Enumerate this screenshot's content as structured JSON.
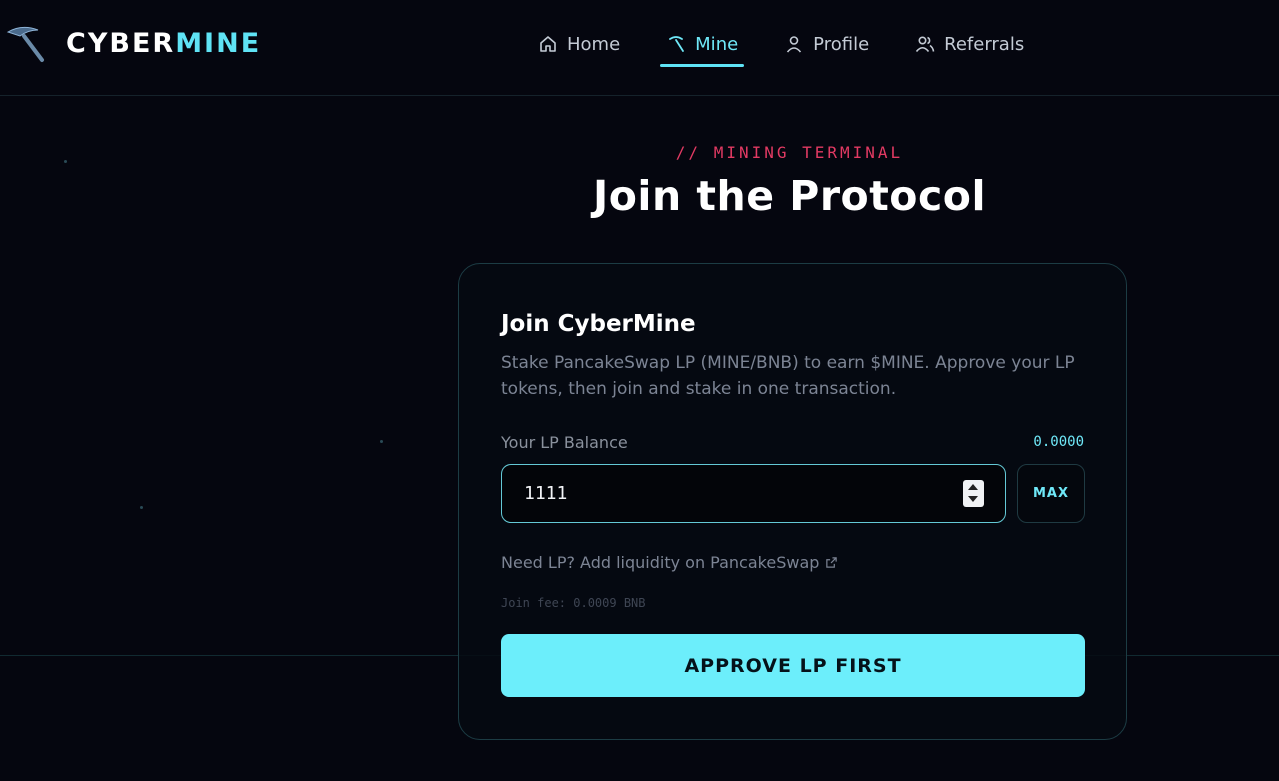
{
  "brand": {
    "part1": "CYBER",
    "part2": "MINE",
    "accent_color": "#5fe3f5"
  },
  "nav": {
    "items": [
      {
        "label": "Home",
        "icon": "home-icon"
      },
      {
        "label": "Mine",
        "icon": "pickaxe-icon",
        "active": true
      },
      {
        "label": "Profile",
        "icon": "user-icon"
      },
      {
        "label": "Referrals",
        "icon": "users-icon"
      }
    ]
  },
  "hero": {
    "kicker": "// MINING TERMINAL",
    "title": "Join the Protocol"
  },
  "card": {
    "title": "Join CyberMine",
    "description": "Stake PancakeSwap LP (MINE/BNB) to earn $MINE. Approve your LP tokens, then join and stake in one transaction.",
    "balance_label": "Your LP Balance",
    "balance_value": "0.0000",
    "amount_value": "1111",
    "max_label": "MAX",
    "lp_link_label": "Need LP? Add liquidity on PancakeSwap",
    "fee_text": "Join fee: 0.0009 BNB",
    "approve_label": "APPROVE LP FIRST"
  },
  "colors": {
    "background": "#05060f",
    "accent": "#6ceefb",
    "kicker": "#e23a63"
  }
}
